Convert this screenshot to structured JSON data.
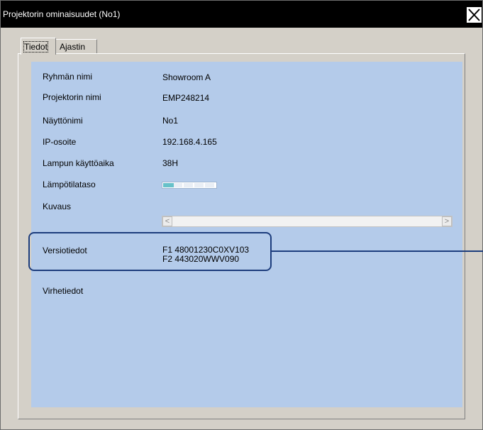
{
  "window": {
    "title": "Projektorin ominaisuudet (No1)"
  },
  "tabs": [
    {
      "label": "Tiedot",
      "active": true
    },
    {
      "label": "Ajastin",
      "active": false
    }
  ],
  "info": {
    "group_name_label": "Ryhmän nimi",
    "group_name_value": "Showroom A",
    "projector_name_label": "Projektorin nimi",
    "projector_name_value": "EMP248214",
    "display_name_label": "Näyttönimi",
    "display_name_value": "No1",
    "ip_label": "IP-osoite",
    "ip_value": "192.168.4.165",
    "lamp_hours_label": "Lampun käyttöaika",
    "lamp_hours_value": "38H",
    "temperature_label": "Lämpötilataso",
    "temperature_level_fraction": 0.2,
    "description_label": "Kuvaus",
    "version_label": "Versiotiedot",
    "version_line1": "F1 48001230C0XV103",
    "version_line2": "F2 443020WWV090",
    "error_label": "Virhetiedot"
  },
  "scrollbar": {
    "left_arrow": "<",
    "right_arrow": ">"
  },
  "colors": {
    "panel_background": "#b4cbea",
    "highlight_border": "#1d3d7d",
    "temperature_fill": "#67c1c9"
  },
  "icons": {
    "close": "close-icon"
  }
}
